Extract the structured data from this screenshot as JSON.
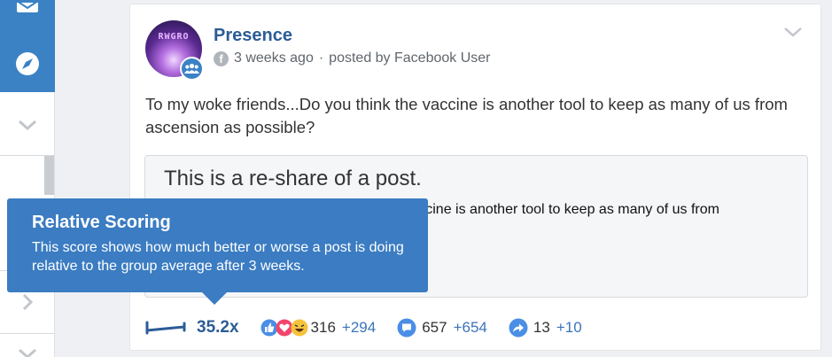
{
  "sidebar": {
    "items": [
      {
        "icon": "mail-icon"
      },
      {
        "icon": "compass-icon"
      },
      {
        "icon": "chevron-down-icon"
      },
      {
        "icon": "chevron-right-icon"
      },
      {
        "icon": "chevron-down-icon"
      }
    ]
  },
  "post": {
    "avatar_text": "RWGRO",
    "group_name": "Presence",
    "time": "3 weeks ago",
    "separator": "·",
    "posted_by": "posted by Facebook User",
    "text": "To my woke friends...Do you think the vaccine is another tool to keep as many of us from ascension as possible?",
    "reshare_title": "This is a re-share of a post.",
    "reshare_text": "To my woke friends...Do you think the vaccine is another tool to keep as many of us from ascension as possible?"
  },
  "stats": {
    "score": "35.2x",
    "reactions": {
      "count": "316",
      "delta": "+294"
    },
    "comments": {
      "count": "657",
      "delta": "+654"
    },
    "shares": {
      "count": "13",
      "delta": "+10"
    }
  },
  "tooltip": {
    "title": "Relative Scoring",
    "body": "This score shows how much better or worse a post is doing relative to the group average after 3 weeks."
  },
  "colors": {
    "brand_blue": "#3b82c4",
    "link_blue": "#2b5c96",
    "tooltip_bg": "#3b7cc2"
  }
}
